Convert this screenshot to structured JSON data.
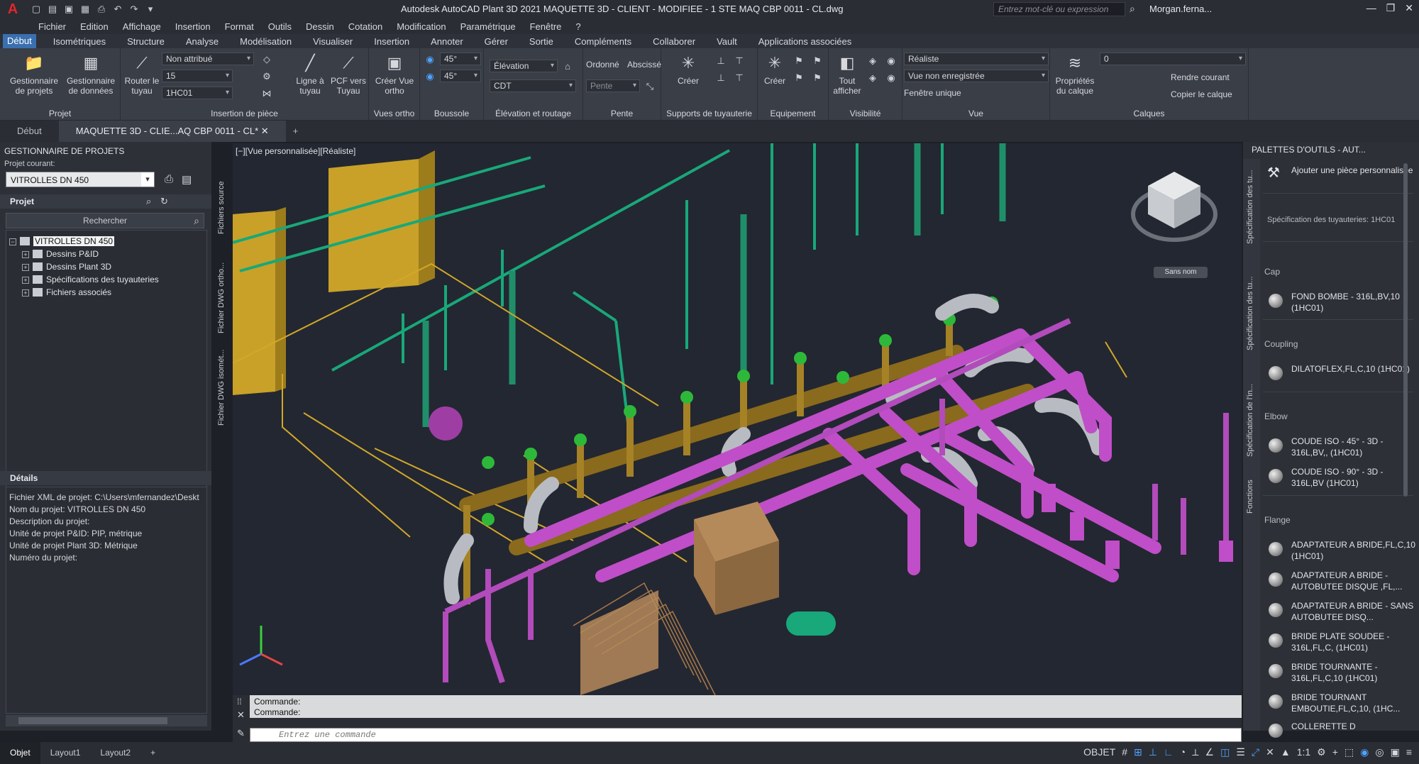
{
  "titlebar": {
    "logo": "A",
    "title": "Autodesk AutoCAD Plant 3D 2021    MAQUETTE 3D - CLIENT - MODIFIEE - 1 STE MAQ CBP 0011 - CL.dwg",
    "search_placeholder": "Entrez mot-clé ou expression",
    "user": "Morgan.ferna...",
    "qat_icons": [
      "new-icon",
      "open-icon",
      "save-icon",
      "saveas-icon",
      "plot-icon",
      "undo-icon",
      "redo-icon"
    ]
  },
  "menu": [
    "Fichier",
    "Edition",
    "Affichage",
    "Insertion",
    "Format",
    "Outils",
    "Dessin",
    "Cotation",
    "Modification",
    "Paramétrique",
    "Fenêtre",
    "?"
  ],
  "ribbon_tabs": [
    "Début",
    "Isométriques",
    "Structure",
    "Analyse",
    "Modélisation",
    "Visualiser",
    "Insertion",
    "Annoter",
    "Gérer",
    "Sortie",
    "Compléments",
    "Collaborer",
    "Vault",
    "Applications associées"
  ],
  "ribbon": {
    "projet": {
      "label": "Projet",
      "btn1": "Gestionnaire de projets",
      "btn2": "Gestionnaire de données"
    },
    "insertion": {
      "label": "Insertion de pièce",
      "router": "Router le tuyau",
      "combo1": "Non attribué",
      "combo2": "15",
      "combo3": "1HC01",
      "ligne": "Ligne à tuyau",
      "pcf": "PCF vers Tuyau"
    },
    "ortho": {
      "label": "Vues ortho",
      "btn": "Créer Vue ortho"
    },
    "boussole": {
      "label": "Boussole",
      "a1": "45°",
      "a2": "45°"
    },
    "elevation": {
      "label": "Élévation et routage",
      "elev": "Élévation",
      "cdt": "CDT"
    },
    "pente": {
      "label": "Pente",
      "ordonnee": "Ordonné",
      "abscisse": "Abscissé",
      "pente": "Pente"
    },
    "supports": {
      "label": "Supports de tuyauterie",
      "btn": "Créer"
    },
    "equipement": {
      "label": "Equipement",
      "btn": "Créer"
    },
    "visibilite": {
      "label": "Visibilité",
      "btn": "Tout afficher"
    },
    "vue": {
      "label": "Vue",
      "style": "Réaliste",
      "view": "Vue non enregistrée",
      "window": "Fenêtre unique"
    },
    "calques": {
      "label": "Calques",
      "props": "Propriétés du calque",
      "layer": "0",
      "rendre": "Rendre courant",
      "copier": "Copier le calque"
    }
  },
  "doc_tabs": [
    "Début",
    "MAQUETTE 3D - CLIE...AQ CBP 0011 - CL*"
  ],
  "left_panel": {
    "title": "GESTIONNAIRE DE PROJETS",
    "current_label": "Projet courant:",
    "current_value": "VITROLLES DN 450",
    "projet_header": "Projet",
    "search_label": "Rechercher",
    "tree_root": "VITROLLES DN 450",
    "tree_items": [
      "Dessins P&ID",
      "Dessins Plant 3D",
      "Spécifications des tuyauteries",
      "Fichiers associés"
    ],
    "vertical_tabs": [
      "Fichiers source",
      "Fichier DWG ortho...",
      "Fichier DWG isomét..."
    ],
    "details_header": "Détails",
    "details": [
      "Fichier XML de projet: C:\\Users\\mfernandez\\Deskt",
      "Nom du projet: VITROLLES DN 450",
      "Description du projet:",
      "Unité de projet P&ID: PIP, métrique",
      "Unité de projet Plant 3D: Métrique",
      "Numéro du projet:"
    ]
  },
  "viewport": {
    "label": "[−][Vue personnalisée][Réaliste]",
    "viewcube_label": "Sans nom",
    "colors": {
      "pipe_magenta": "#c04ec8",
      "pipe_brass": "#8a6a1c",
      "pipe_green": "#18a87a",
      "pipe_grey": "#b8bcc2",
      "equip_yellow": "#c9a128",
      "flange_green": "#2eb83a",
      "box_tan": "#b58a5a"
    }
  },
  "command": {
    "history": [
      "Commande:",
      "Commande:"
    ],
    "placeholder": "Entrez une commande"
  },
  "right_panel": {
    "title": "PALETTES D'OUTILS - AUT...",
    "add_piece": "Ajouter une pièce personnalisée",
    "spec": "Spécification des tuyauteries: 1HC01",
    "vertical_tabs": [
      "Spécification des tu...",
      "Spécification des tu...",
      "Spécification de l'in...",
      "Fonctions"
    ],
    "groups": [
      {
        "name": "Cap",
        "items": [
          "FOND BOMBE - 316L,BV,10 (1HC01)"
        ]
      },
      {
        "name": "Coupling",
        "items": [
          "DILATOFLEX,FL,C,10 (1HC01)"
        ]
      },
      {
        "name": "Elbow",
        "items": [
          "COUDE ISO - 45° - 3D - 316L,BV,, (1HC01)",
          "COUDE ISO - 90° - 3D - 316L,BV (1HC01)"
        ]
      },
      {
        "name": "Flange",
        "items": [
          "ADAPTATEUR A BRIDE,FL,C,10 (1HC01)",
          "ADAPTATEUR A BRIDE - AUTOBUTEE DISQUE ,FL,...",
          "ADAPTATEUR A BRIDE - SANS AUTOBUTEE DISQ...",
          "BRIDE PLATE SOUDEE - 316L,FL,C, (1HC01)",
          "BRIDE TOURNANTE - 316L,FL,C,10 (1HC01)",
          "BRIDE TOURNANT EMBOUTIE,FL,C,10, (1HC...",
          "COLLERETTE D"
        ]
      }
    ]
  },
  "status": {
    "tabs": [
      "Objet",
      "Layout1",
      "Layout2",
      "+"
    ],
    "objet": "OBJET",
    "scale": "1:1"
  }
}
